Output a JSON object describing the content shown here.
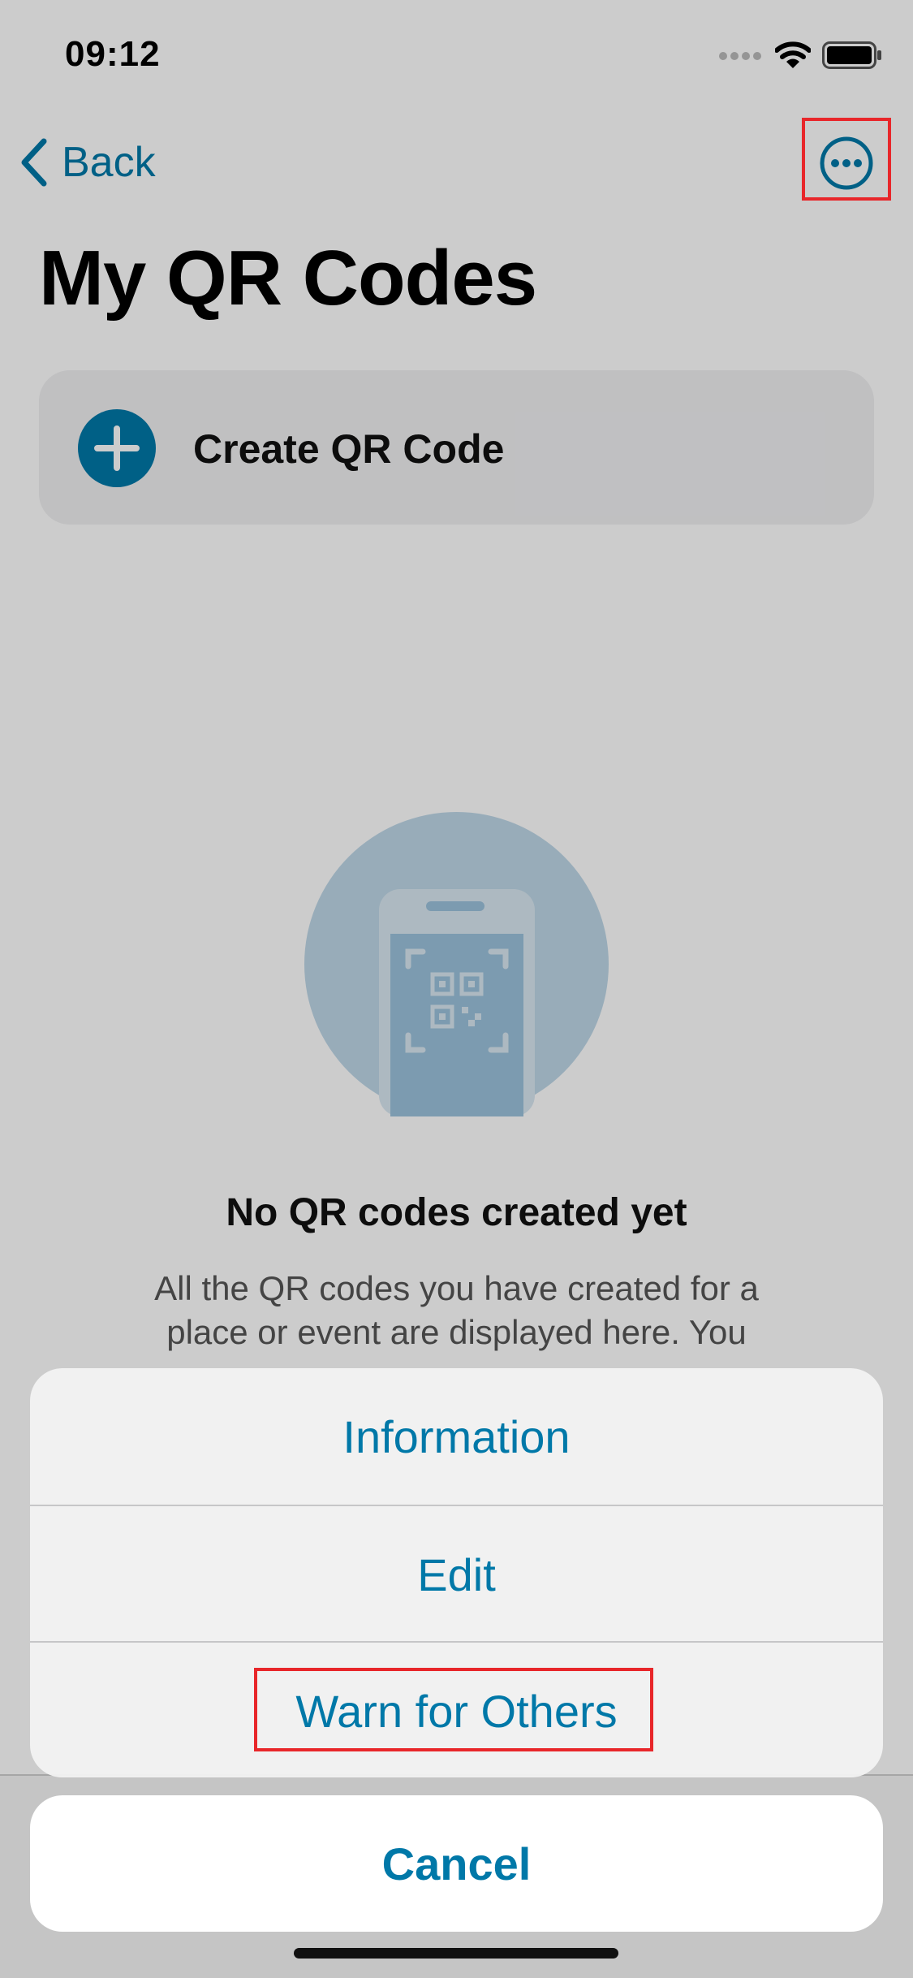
{
  "status_bar": {
    "time": "09:12"
  },
  "nav": {
    "back_label": "Back"
  },
  "page": {
    "title": "My QR Codes"
  },
  "create_card": {
    "label": "Create QR Code"
  },
  "empty_state": {
    "title": "No QR codes created yet",
    "description": "All the QR codes you have created for a place or event are displayed here. You"
  },
  "action_sheet": {
    "items": [
      "Information",
      "Edit",
      "Warn for Others"
    ],
    "cancel_label": "Cancel"
  },
  "colors": {
    "accent": "#0078a8",
    "highlight": "#e8262a"
  },
  "icons": {
    "back": "chevron-left-icon",
    "more": "ellipsis-circle-icon",
    "create": "plus-circle-icon",
    "signal": "cellular-signal-icon",
    "wifi": "wifi-icon",
    "battery": "battery-icon"
  }
}
